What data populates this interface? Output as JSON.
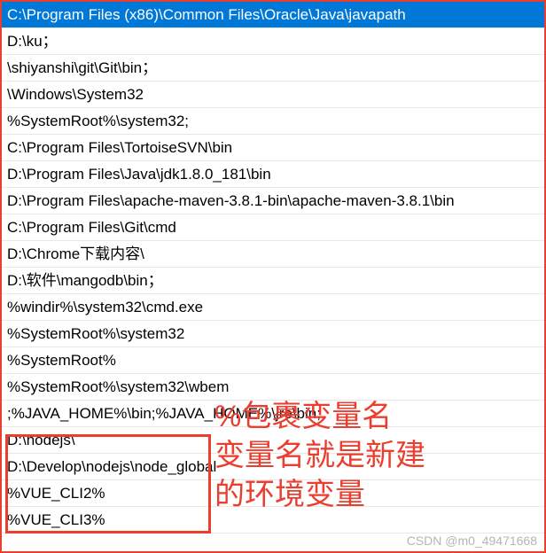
{
  "path_entries": [
    {
      "text": "C:\\Program Files (x86)\\Common Files\\Oracle\\Java\\javapath",
      "selected": true
    },
    {
      "text": "D:\\ku；",
      "selected": false
    },
    {
      "text": "\\shiyanshi\\git\\Git\\bin；",
      "selected": false
    },
    {
      "text": "\\Windows\\System32",
      "selected": false
    },
    {
      "text": "%SystemRoot%\\system32;",
      "selected": false
    },
    {
      "text": "C:\\Program Files\\TortoiseSVN\\bin",
      "selected": false
    },
    {
      "text": "D:\\Program Files\\Java\\jdk1.8.0_181\\bin",
      "selected": false
    },
    {
      "text": "D:\\Program Files\\apache-maven-3.8.1-bin\\apache-maven-3.8.1\\bin",
      "selected": false
    },
    {
      "text": "C:\\Program Files\\Git\\cmd",
      "selected": false
    },
    {
      "text": "D:\\Chrome下载内容\\",
      "selected": false
    },
    {
      "text": "D:\\软件\\mangodb\\bin；",
      "selected": false
    },
    {
      "text": "%windir%\\system32\\cmd.exe",
      "selected": false
    },
    {
      "text": "%SystemRoot%\\system32",
      "selected": false
    },
    {
      "text": "%SystemRoot%",
      "selected": false
    },
    {
      "text": "%SystemRoot%\\system32\\wbem",
      "selected": false
    },
    {
      "text": ";%JAVA_HOME%\\bin;%JAVA_HOME%\\jre\\bin;",
      "selected": false
    },
    {
      "text": "D:\\nodejs\\",
      "selected": false
    },
    {
      "text": "D:\\Develop\\nodejs\\node_global",
      "selected": false
    },
    {
      "text": "%VUE_CLI2%",
      "selected": false
    },
    {
      "text": "%VUE_CLI3%",
      "selected": false
    }
  ],
  "annotation": {
    "line1": "%包裹变量名",
    "line2": "变量名就是新建",
    "line3": "的环境变量"
  },
  "watermark": "CSDN @m0_49471668"
}
